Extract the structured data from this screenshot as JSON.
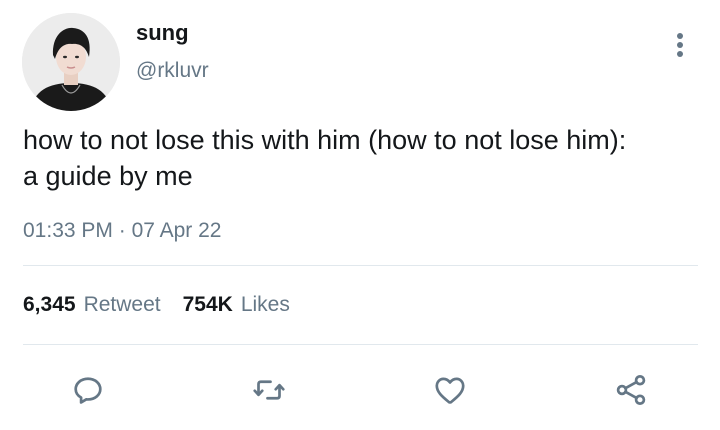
{
  "user": {
    "display_name": "sung",
    "handle": "@rkluvr",
    "avatar_icon": "avatar-photo"
  },
  "tweet": {
    "text_line1": "how to not lose this with him (how to not lose him):",
    "text_line2": "a guide by me",
    "time": "01:33 PM",
    "separator": "·",
    "date": "07 Apr 22"
  },
  "stats": {
    "retweets_count": "6,345",
    "retweets_label": "Retweet",
    "likes_count": "754K",
    "likes_label": "Likes"
  },
  "actions": {
    "reply_icon": "reply-icon",
    "retweet_icon": "retweet-icon",
    "like_icon": "heart-icon",
    "share_icon": "share-icon"
  },
  "colors": {
    "text": "#14171a",
    "secondary": "#657786",
    "divider": "#e1e8ed"
  }
}
